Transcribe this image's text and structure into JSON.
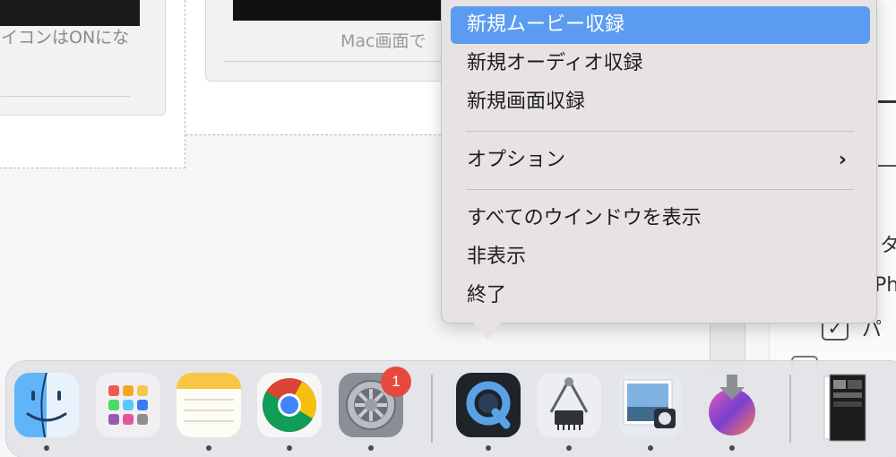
{
  "background": {
    "left_card_caption": "イコンはONにな",
    "middle_card_caption": "Mac画面で",
    "right_panel": {
      "text_1": "タ",
      "text_2": "Ph",
      "text_3": "パ",
      "checkbox_mark": "✓"
    }
  },
  "menu": {
    "items": [
      {
        "label": "新規ムービー収録",
        "active": true
      },
      {
        "label": "新規オーディオ収録"
      },
      {
        "label": "新規画面収録"
      },
      {
        "label": "オプション",
        "has_submenu": true
      },
      {
        "label": "すべてのウインドウを表示"
      },
      {
        "label": "非表示"
      },
      {
        "label": "終了"
      }
    ],
    "submenu_chevron": "›",
    "active_color": "#5b9cf0"
  },
  "dock": {
    "apps": [
      {
        "name": "Finder",
        "icon": "finder-icon",
        "running": true
      },
      {
        "name": "Launchpad",
        "icon": "launchpad-icon",
        "running": false
      },
      {
        "name": "Notes",
        "icon": "notes-icon",
        "running": true
      },
      {
        "name": "Google Chrome",
        "icon": "chrome-icon",
        "running": true
      },
      {
        "name": "System Preferences",
        "icon": "settings-icon",
        "running": true,
        "badge": "1"
      },
      {
        "name": "QuickTime Player",
        "icon": "quicktime-icon",
        "running": true
      },
      {
        "name": "System Information",
        "icon": "system-information-icon",
        "running": true
      },
      {
        "name": "Preview",
        "icon": "preview-icon",
        "running": true
      },
      {
        "name": "Install macOS Monterey",
        "icon": "monterey-installer-icon",
        "running": true
      },
      {
        "name": "Stack",
        "icon": "stack-icon",
        "running": false
      }
    ],
    "badge_color": "#e64a3f"
  }
}
